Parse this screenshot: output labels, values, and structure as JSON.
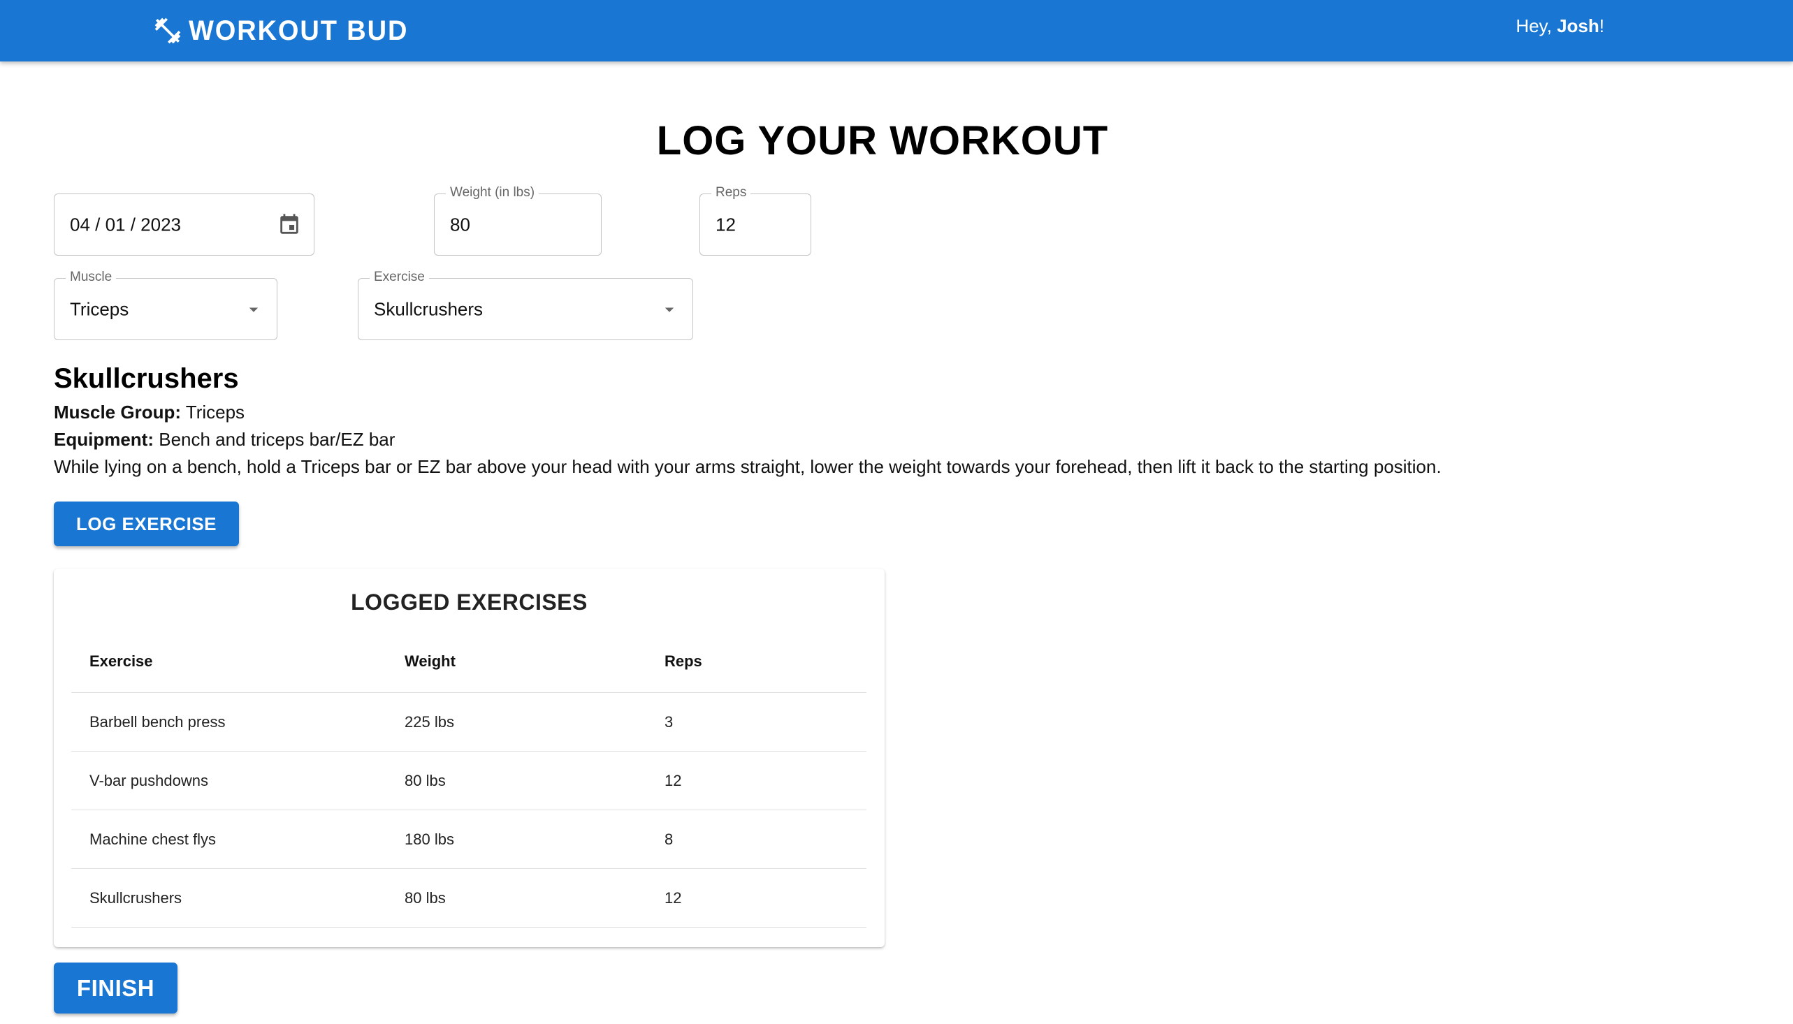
{
  "header": {
    "brand": "WORKOUT BUD",
    "greeting_prefix": "Hey, ",
    "user_name": "Josh",
    "greeting_suffix": "!",
    "brand_color": "#1976d2",
    "logo_icon": "dumbbell-icon"
  },
  "page_title": "LOG YOUR WORKOUT",
  "form": {
    "date": {
      "value": "04 / 01 / 2023",
      "icon": "calendar-icon"
    },
    "weight": {
      "label": "Weight (in lbs)",
      "value": "80"
    },
    "reps": {
      "label": "Reps",
      "value": "12"
    },
    "muscle": {
      "label": "Muscle",
      "value": "Triceps",
      "icon": "arrow-drop-down-icon"
    },
    "exercise": {
      "label": "Exercise",
      "value": "Skullcrushers",
      "icon": "arrow-drop-down-icon"
    }
  },
  "exercise_details": {
    "name": "Skullcrushers",
    "muscle_group_label": "Muscle Group:",
    "muscle_group": "Triceps",
    "equipment_label": "Equipment:",
    "equipment": "Bench and triceps bar/EZ bar",
    "description": "While lying on a bench, hold a Triceps bar or EZ bar above your head with your arms straight, lower the weight towards your forehead, then lift it back to the starting position."
  },
  "log_button": "LOG EXERCISE",
  "logged": {
    "title": "LOGGED EXERCISES",
    "columns": [
      "Exercise",
      "Weight",
      "Reps"
    ],
    "rows": [
      [
        "Barbell bench press",
        "225 lbs",
        "3"
      ],
      [
        "V-bar pushdowns",
        "80 lbs",
        "12"
      ],
      [
        "Machine chest flys",
        "180 lbs",
        "8"
      ],
      [
        "Skullcrushers",
        "80 lbs",
        "12"
      ]
    ]
  },
  "finish_button": "FINISH"
}
